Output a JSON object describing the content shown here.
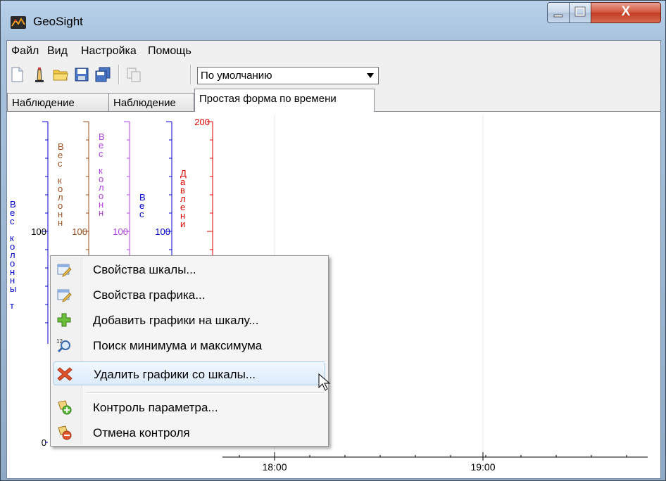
{
  "window": {
    "title": "GeoSight",
    "close_glyph": "X"
  },
  "menu": [
    "Файл",
    "Вид",
    "Настройка",
    "Помощь"
  ],
  "toolbar": {
    "icons": [
      "new-file-icon",
      "tower-icon",
      "open-folder-icon",
      "save-icon",
      "save-all-icon",
      "copy-icon"
    ],
    "profile_select": "По умолчанию"
  },
  "tabs": [
    {
      "label": "Наблюдение",
      "active": false
    },
    {
      "label": "Наблюдение",
      "active": false
    },
    {
      "label": "Простая форма по времени",
      "active": true
    }
  ],
  "scales": [
    {
      "label": "Вес колонны т",
      "color": "#0000cc",
      "top_tick": "",
      "mid_tick": "100",
      "bottom_tick": "0"
    },
    {
      "label": "Вес колонн",
      "color": "#9b4d1e",
      "top_tick": "",
      "mid_tick": "100",
      "bottom_tick": ""
    },
    {
      "label": "Вес колонн",
      "color": "#b040e0",
      "top_tick": "",
      "mid_tick": "100",
      "bottom_tick": ""
    },
    {
      "label": "Вес",
      "color": "#0000cc",
      "top_tick": "",
      "mid_tick": "100",
      "bottom_tick": ""
    },
    {
      "label": "Давлени",
      "color": "#e00000",
      "top_tick": "200",
      "mid_tick": "",
      "bottom_tick": ""
    }
  ],
  "time_axis": {
    "ticks": [
      "18:00",
      "19:00"
    ]
  },
  "context_menu": [
    {
      "label": "Свойства шкалы...",
      "icon": "scale-properties-icon"
    },
    {
      "label": "Свойства графика...",
      "icon": "chart-properties-icon"
    },
    {
      "label": "Добавить графики на шкалу...",
      "icon": "add-green-plus-icon"
    },
    {
      "label": "Поиск минимума и максимума",
      "icon": "search-minmax-icon"
    },
    {
      "label": "Удалить графики со шкалы...",
      "icon": "delete-red-x-icon",
      "hover": true
    },
    {
      "label": "Контроль параметра...",
      "icon": "control-add-icon"
    },
    {
      "label": "Отмена контроля",
      "icon": "control-cancel-icon"
    }
  ],
  "colors": {
    "accent_red": "#e00000",
    "scale_blue": "#0000cc",
    "scale_brown": "#9b4d1e",
    "scale_purple": "#b040e0"
  }
}
